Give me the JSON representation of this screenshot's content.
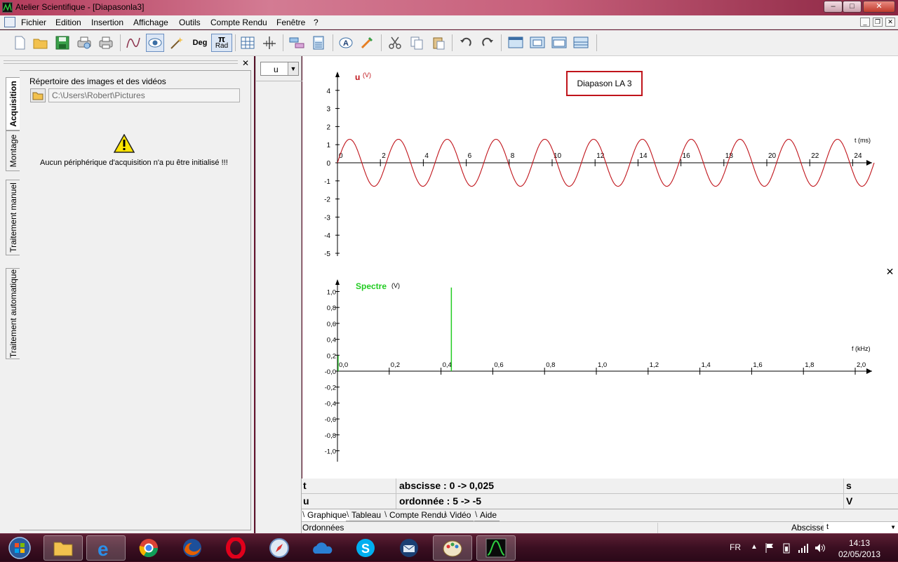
{
  "window": {
    "title": "Atelier Scientifique - [Diapasonla3]"
  },
  "window_buttons": {
    "minimize": "–",
    "maximize": "□",
    "close": "✕"
  },
  "menu": [
    "Fichier",
    "Edition",
    "Insertion",
    "Affichage",
    "Outils",
    "Compte Rendu",
    "Fenêtre",
    "?"
  ],
  "toolbar": {
    "deg_label": "Deg",
    "rad_label": "Rad",
    "pi_symbol": "π"
  },
  "left_panel": {
    "close": "✕",
    "tabs": [
      "Acquisition",
      "Montage",
      "Traitement manuel",
      "Traitement automatique"
    ],
    "repo_label": "Répertoire des images et des vidéos",
    "path_value": "C:\\Users\\Robert\\Pictures",
    "warning_message": "Aucun périphérique d'acquisition n'a pu être initialisé !!!"
  },
  "var_select": {
    "value": "u"
  },
  "graph": {
    "legend": "Diapason LA 3",
    "close": "✕",
    "top": {
      "y_name": "u",
      "y_unit": "(V)",
      "x_unit": "t (ms)",
      "y_ticks": [
        "4",
        "3",
        "2",
        "1",
        "0",
        "-1",
        "-2",
        "-3",
        "-4",
        "-5"
      ],
      "x_ticks": [
        "0",
        "2",
        "4",
        "6",
        "8",
        "10",
        "12",
        "14",
        "16",
        "18",
        "20",
        "22",
        "24"
      ],
      "color": "#c0141b"
    },
    "bottom": {
      "y_name": "Spectre",
      "y_unit": "(V)",
      "x_unit": "f (kHz)",
      "y_ticks": [
        "1,0",
        "0,8",
        "0,6",
        "0,4",
        "0,2",
        "-0,0",
        "-0,2",
        "-0,4",
        "-0,6",
        "-0,8",
        "-1,0"
      ],
      "x_ticks": [
        "0,0",
        "0,2",
        "0,4",
        "0,6",
        "0,8",
        "1,0",
        "1,2",
        "1,4",
        "1,6",
        "1,8",
        "2,0"
      ],
      "color": "#22cc22"
    }
  },
  "chart_data": [
    {
      "type": "line",
      "y_name": "u",
      "y_unit": "(V)",
      "x_unit": "t (ms)",
      "signal": "sinusoid",
      "amplitude_V": 1.3,
      "frequency_Hz": 440,
      "x_range_ms": [
        0,
        25
      ],
      "ylim": [
        -5,
        4.5
      ]
    },
    {
      "type": "bar",
      "y_name": "Spectre",
      "y_unit": "(V)",
      "x_unit": "f (kHz)",
      "peaks": [
        {
          "f_kHz": 0.44,
          "amplitude_V": 1.05
        }
      ],
      "xlim": [
        0,
        2.0
      ],
      "ylim": [
        -1.0,
        1.05
      ]
    }
  ],
  "info_rows": [
    {
      "var": "t",
      "range": "abscisse : 0 -> 0,025",
      "unit": "s"
    },
    {
      "var": "u",
      "range": "ordonnée : 5 -> -5",
      "unit": "V"
    }
  ],
  "bottom_tabs": [
    "Graphique",
    "Tableau",
    "Compte Rendu",
    "Vidéo",
    "Aide"
  ],
  "status": {
    "left": "Ordonnées",
    "abscisse_label": "Abscisse",
    "abscisse_value": "t"
  },
  "tray": {
    "lang": "FR",
    "time": "14:13",
    "date": "02/05/2013"
  },
  "taskbar_items": [
    "start-orb",
    "explorer",
    "internet-explorer",
    "chrome",
    "firefox",
    "opera",
    "safari",
    "onedrive",
    "skype",
    "thunderbird",
    "paint",
    "atelier-scientifique"
  ]
}
